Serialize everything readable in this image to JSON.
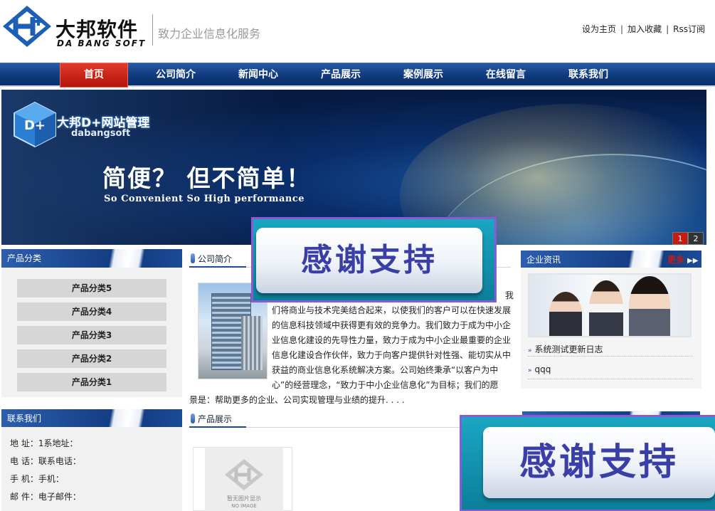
{
  "header": {
    "logo_cn": "大邦软件",
    "logo_en": "DA BANG SOFT",
    "slogan": "致力企业信息化服务",
    "links": [
      "设为主页",
      "加入收藏",
      "Rss订阅"
    ],
    "separator": "|"
  },
  "nav": {
    "items": [
      "首页",
      "公司简介",
      "新闻中心",
      "产品展示",
      "案例展示",
      "在线留言",
      "联系我们"
    ],
    "active_index": 0
  },
  "banner": {
    "brand": "大邦D+网站管理",
    "brand_sub": "dabangsoft",
    "logo_text": "D+",
    "slogan": "简便？ 但不简单！",
    "slogan_en": "So Convenient   So High performance",
    "pages": [
      "1",
      "2"
    ],
    "active_page": "1"
  },
  "categories": {
    "title": "产品分类",
    "items": [
      "产品分类5",
      "产品分类4",
      "产品分类3",
      "产品分类2",
      "产品分类1"
    ]
  },
  "contact": {
    "title": "联系我们",
    "lines": [
      "地  址：1系地址：",
      "电  话：联系电话：",
      "手  机：手机：",
      "邮  件：电子邮件："
    ]
  },
  "about": {
    "title": "公司简介",
    "para_lines": [
      "我",
      "们将商业与技术完美结合起来，以使我们的客户可以在快速发展",
      "的信息科技领域中获得更有效的竞争力。我们致力于成为中小企",
      "业信息化建设的先导性力量，致力于成为中小企业最重要的企业",
      "信息化建设合作伙伴，致力于向客户提供针对性强、能切实从中",
      "获益的商业信息化系统解决方案。公司始终秉承“以客户为中",
      "心”的经营理念，“致力于中小企业信息化”为目标；我们的愿"
    ],
    "last_line": "景是：帮助更多的企业、公司实现管理与业绩的提升. . . ."
  },
  "products": {
    "title": "产品展示",
    "placeholder_cn": "暂无图片显示",
    "placeholder_en": "NO IMAGE"
  },
  "news": {
    "title": "企业资讯",
    "more": "更多",
    "items": [
      "系统测试更新日志",
      "qqq"
    ]
  },
  "overlay": {
    "text": "感谢支持"
  },
  "colors": {
    "nav_blue": "#0f3a7e",
    "active_red": "#c41c12",
    "overlay_teal": "#1aa6c2",
    "overlay_text": "#3a3fa8"
  }
}
